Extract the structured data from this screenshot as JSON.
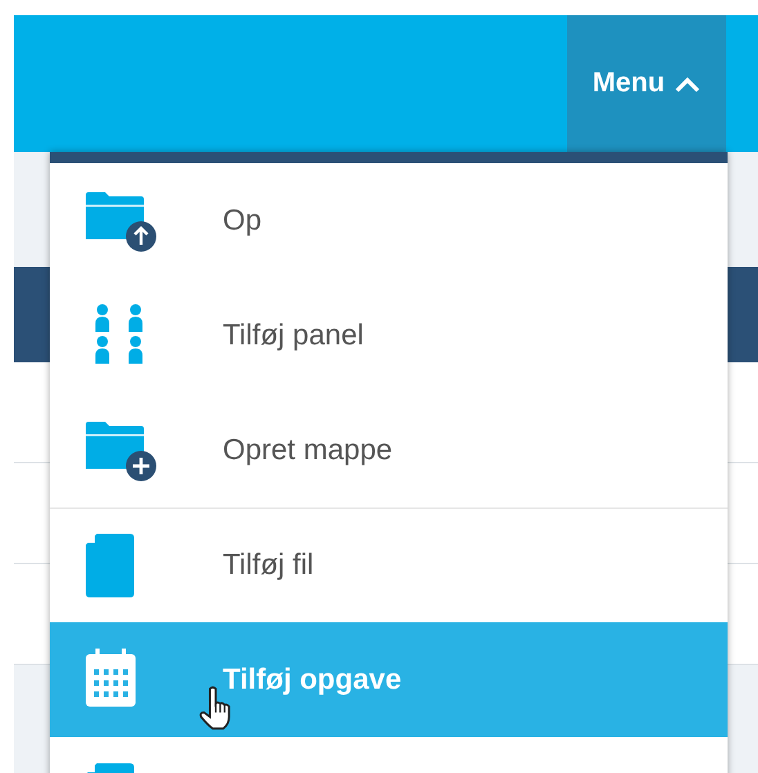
{
  "top_bar": {
    "menu_button": {
      "label": "Menu",
      "expanded": true
    }
  },
  "menu": {
    "items": [
      {
        "kind": "folder-up",
        "label": "Op",
        "selected": false,
        "separator_above": false
      },
      {
        "kind": "people",
        "label": "Tilføj panel",
        "selected": false,
        "separator_above": false
      },
      {
        "kind": "folder-plus",
        "label": "Opret mappe",
        "selected": false,
        "separator_above": false
      },
      {
        "kind": "file",
        "label": "Tilføj fil",
        "selected": false,
        "separator_above": true
      },
      {
        "kind": "calendar",
        "label": "Tilføj opgave",
        "selected": true,
        "separator_above": false
      },
      {
        "kind": "file",
        "selected": false,
        "separator_above": false
      }
    ]
  }
}
